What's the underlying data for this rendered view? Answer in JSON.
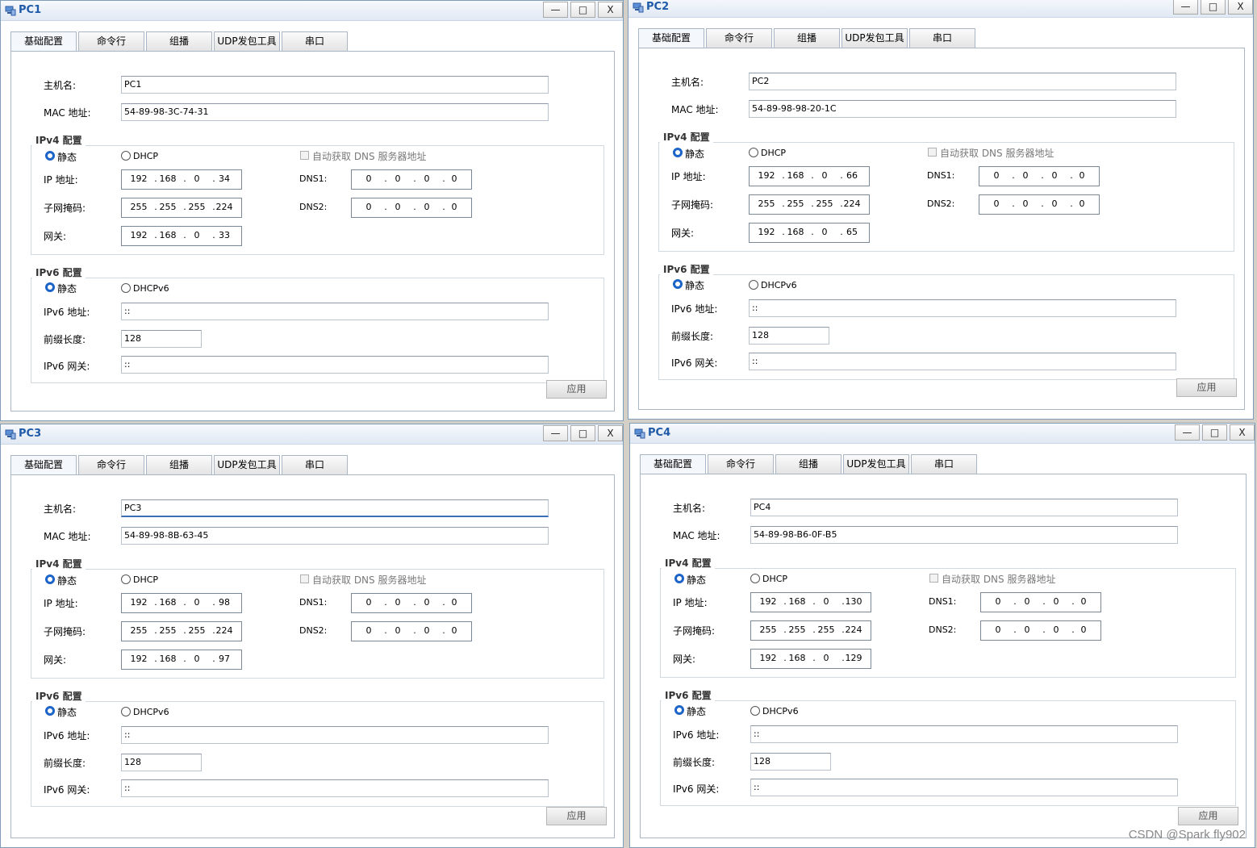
{
  "common": {
    "tabs": [
      "基础配置",
      "命令行",
      "组播",
      "UDP发包工具",
      "串口"
    ],
    "labels": {
      "hostname": "主机名:",
      "mac": "MAC 地址:",
      "ipv4_group": "IPv4 配置",
      "static": "静态",
      "dhcp": "DHCP",
      "auto_dns": "自动获取 DNS 服务器地址",
      "ip": "IP 地址:",
      "mask": "子网掩码:",
      "gateway": "网关:",
      "dns1": "DNS1:",
      "dns2": "DNS2:",
      "ipv6_group": "IPv6 配置",
      "dhcpv6": "DHCPv6",
      "ipv6_addr": "IPv6 地址:",
      "prefix": "前缀长度:",
      "ipv6_gw": "IPv6 网关:"
    },
    "apply_label": "应用",
    "min_glyph": "—",
    "max_glyph": "□",
    "close_glyph": "X"
  },
  "windows": [
    {
      "title": "PC1",
      "hostname": "PC1",
      "mac": "54-89-98-3C-74-31",
      "ip": [
        "192",
        "168",
        "0",
        "34"
      ],
      "mask": [
        "255",
        "255",
        "255",
        "224"
      ],
      "gateway": [
        "192",
        "168",
        "0",
        "33"
      ],
      "dns1": [
        "0",
        "0",
        "0",
        "0"
      ],
      "dns2": [
        "0",
        "0",
        "0",
        "0"
      ],
      "ipv6_addr": "::",
      "prefix": "128",
      "ipv6_gw": "::"
    },
    {
      "title": "PC2",
      "hostname": "PC2",
      "mac": "54-89-98-98-20-1C",
      "ip": [
        "192",
        "168",
        "0",
        "66"
      ],
      "mask": [
        "255",
        "255",
        "255",
        "224"
      ],
      "gateway": [
        "192",
        "168",
        "0",
        "65"
      ],
      "dns1": [
        "0",
        "0",
        "0",
        "0"
      ],
      "dns2": [
        "0",
        "0",
        "0",
        "0"
      ],
      "ipv6_addr": "::",
      "prefix": "128",
      "ipv6_gw": "::"
    },
    {
      "title": "PC3",
      "hostname": "PC3",
      "mac": "54-89-98-8B-63-45",
      "ip": [
        "192",
        "168",
        "0",
        "98"
      ],
      "mask": [
        "255",
        "255",
        "255",
        "224"
      ],
      "gateway": [
        "192",
        "168",
        "0",
        "97"
      ],
      "dns1": [
        "0",
        "0",
        "0",
        "0"
      ],
      "dns2": [
        "0",
        "0",
        "0",
        "0"
      ],
      "ipv6_addr": "::",
      "prefix": "128",
      "ipv6_gw": "::"
    },
    {
      "title": "PC4",
      "hostname": "PC4",
      "mac": "54-89-98-B6-0F-B5",
      "ip": [
        "192",
        "168",
        "0",
        "130"
      ],
      "mask": [
        "255",
        "255",
        "255",
        "224"
      ],
      "gateway": [
        "192",
        "168",
        "0",
        "129"
      ],
      "dns1": [
        "0",
        "0",
        "0",
        "0"
      ],
      "dns2": [
        "0",
        "0",
        "0",
        "0"
      ],
      "ipv6_addr": "::",
      "prefix": "128",
      "ipv6_gw": "::"
    }
  ],
  "watermark": "CSDN @Spark fly902",
  "colors": {
    "accent": "#1d64c8",
    "title_text": "#1f5aa8"
  }
}
